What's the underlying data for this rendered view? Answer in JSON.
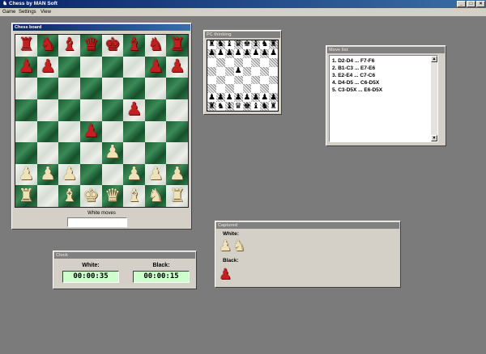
{
  "app": {
    "title": "Chess by MAN Soft",
    "icon": "chess-app-icon",
    "window_controls": {
      "minimize": "_",
      "maximize": "□",
      "close": "×"
    }
  },
  "menu": [
    "Game",
    "Settings",
    "View"
  ],
  "chess_board": {
    "caption": "Chess board",
    "status_label": "White moves",
    "status_value": "",
    "rows": [
      [
        "br",
        "bn",
        "bb",
        "bq",
        "bk",
        "bb",
        "bn",
        "br"
      ],
      [
        "bp",
        "bp",
        "",
        "",
        "",
        "",
        "bp",
        "bp"
      ],
      [
        "",
        "",
        "",
        "",
        "",
        "",
        "",
        ""
      ],
      [
        "",
        "",
        "",
        "",
        "",
        "bp",
        "",
        ""
      ],
      [
        "",
        "",
        "",
        "bp",
        "",
        "",
        "",
        ""
      ],
      [
        "",
        "",
        "",
        "",
        "wp",
        "",
        "",
        ""
      ],
      [
        "wp",
        "wp",
        "wp",
        "",
        "",
        "wp",
        "wp",
        "wp"
      ],
      [
        "wr",
        "",
        "wb",
        "wk",
        "wq",
        "wb",
        "wn",
        "wr"
      ]
    ]
  },
  "pc_thinking": {
    "caption": "PC thinking",
    "rows": [
      [
        "br",
        "bn",
        "bb",
        "bq",
        "bk",
        "bb",
        "bn",
        "br"
      ],
      [
        "bp",
        "bp",
        "bp",
        "bp",
        "bp",
        "bp",
        "bp",
        "bp"
      ],
      [
        "",
        "",
        "",
        "",
        "",
        "",
        "",
        ""
      ],
      [
        "",
        "",
        "",
        "bp",
        "",
        "",
        "",
        ""
      ],
      [
        "",
        "",
        "",
        "",
        "",
        "",
        "",
        ""
      ],
      [
        "",
        "",
        "",
        "",
        "",
        "",
        "",
        ""
      ],
      [
        "wp",
        "wp",
        "wp",
        "wp",
        "wp",
        "wp",
        "wp",
        "wp"
      ],
      [
        "wr",
        "wn",
        "wb",
        "wq",
        "wk",
        "wb",
        "wn",
        "wr"
      ]
    ]
  },
  "move_list": {
    "caption": "Move list",
    "moves": [
      "1. D2-D4 ... F7-F6",
      "2. B1-C3 ... E7-E6",
      "3. E2-E4 ... C7-C6",
      "4. D4-D5 ... C6-D5X",
      "5. C3-D5X ... E6-D5X"
    ]
  },
  "captured": {
    "caption": "Captured",
    "white_label": "White:",
    "white_pieces": [
      "wp",
      "wn"
    ],
    "black_label": "Black:",
    "black_pieces": [
      "bp"
    ]
  },
  "clock": {
    "caption": "Clock",
    "white_label": "White:",
    "white_time": "00:00:35",
    "black_label": "Black:",
    "black_time": "00:00:15"
  },
  "colors": {
    "titlebar": "#0a246a",
    "desktop": "#7b7b7b",
    "window_face": "#d4d0c8",
    "light_square": "#e6ebe4",
    "dark_square": "#2a7240",
    "black_piece": "#c22020",
    "white_piece": "#efe1b8",
    "clock_display": "#ccffcc"
  }
}
